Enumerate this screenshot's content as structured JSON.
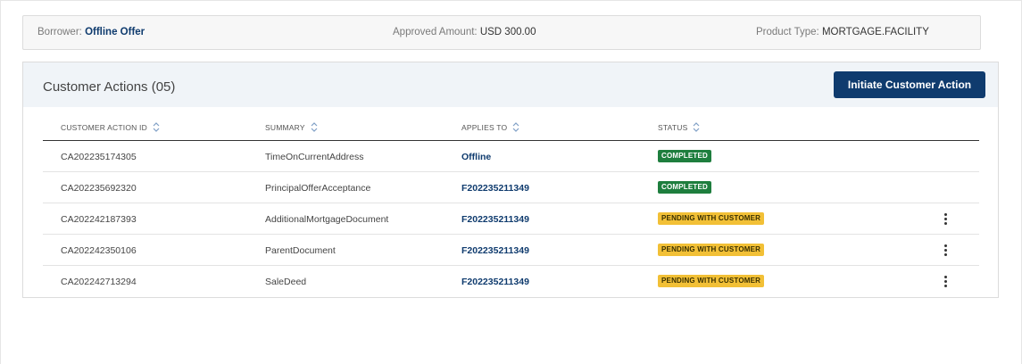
{
  "summary": {
    "borrower_label": "Borrower:",
    "borrower_value": "Offline Offer",
    "approved_label": "Approved Amount:",
    "approved_value": "USD 300.00",
    "product_label": "Product Type:",
    "product_value": "MORTGAGE.FACILITY"
  },
  "panel": {
    "title": "Customer Actions (05)",
    "initiate_button": "Initiate Customer Action"
  },
  "table": {
    "columns": [
      "CUSTOMER ACTION ID",
      "SUMMARY",
      "APPLIES TO",
      "STATUS"
    ],
    "rows": [
      {
        "id": "CA202235174305",
        "summary": "TimeOnCurrentAddress",
        "applies_to": "Offline",
        "status": "COMPLETED",
        "status_type": "completed",
        "has_menu": false
      },
      {
        "id": "CA202235692320",
        "summary": "PrincipalOfferAcceptance",
        "applies_to": "F202235211349",
        "status": "COMPLETED",
        "status_type": "completed",
        "has_menu": false
      },
      {
        "id": "CA202242187393",
        "summary": "AdditionalMortgageDocument",
        "applies_to": "F202235211349",
        "status": "PENDING WITH CUSTOMER",
        "status_type": "pending",
        "has_menu": true
      },
      {
        "id": "CA202242350106",
        "summary": "ParentDocument",
        "applies_to": "F202235211349",
        "status": "PENDING WITH CUSTOMER",
        "status_type": "pending",
        "has_menu": true
      },
      {
        "id": "CA202242713294",
        "summary": "SaleDeed",
        "applies_to": "F202235211349",
        "status": "PENDING WITH CUSTOMER",
        "status_type": "pending",
        "has_menu": true
      }
    ]
  },
  "icons": {
    "sort": "sort-icon",
    "row_menu": "more-vertical-icon"
  },
  "colors": {
    "primary": "#0f3b6e",
    "completed": "#1e7e3e",
    "pending": "#f2c036"
  }
}
